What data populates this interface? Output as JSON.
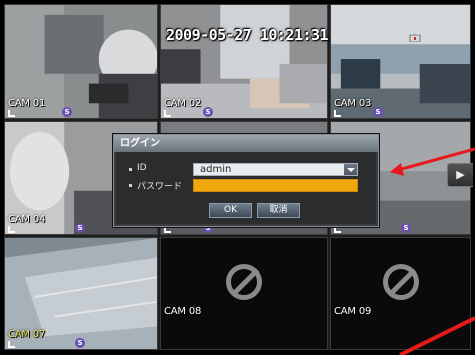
{
  "cameras": [
    {
      "label": "CAM 01",
      "rec": "S"
    },
    {
      "label": "CAM 02",
      "rec": "S"
    },
    {
      "label": "CAM 03",
      "rec": "S"
    },
    {
      "label": "CAM 04",
      "rec": "S"
    },
    {
      "label": "",
      "rec": "S"
    },
    {
      "label": "",
      "rec": "S"
    },
    {
      "label": "CAM 07",
      "rec": "S"
    },
    {
      "label": "CAM 08",
      "rec": ""
    },
    {
      "label": "CAM 09",
      "rec": ""
    }
  ],
  "timestamp": "2009-05-27 10:21:31",
  "side_button": "▶",
  "login_dialog": {
    "title": "ログイン",
    "id_label": "ID",
    "id_value": "admin",
    "password_label": "パスワード",
    "password_value": "",
    "ok_label": "OK",
    "cancel_label": "取消"
  },
  "colors": {
    "password_field": "#f1a80e",
    "annotation_arrow": "#e8191a",
    "rec_badge": "#6a4fb3"
  },
  "icons": [
    "lock-icon",
    "no-signal-icon",
    "dropdown-arrow-icon",
    "status-icon",
    "record-badge-icon"
  ]
}
